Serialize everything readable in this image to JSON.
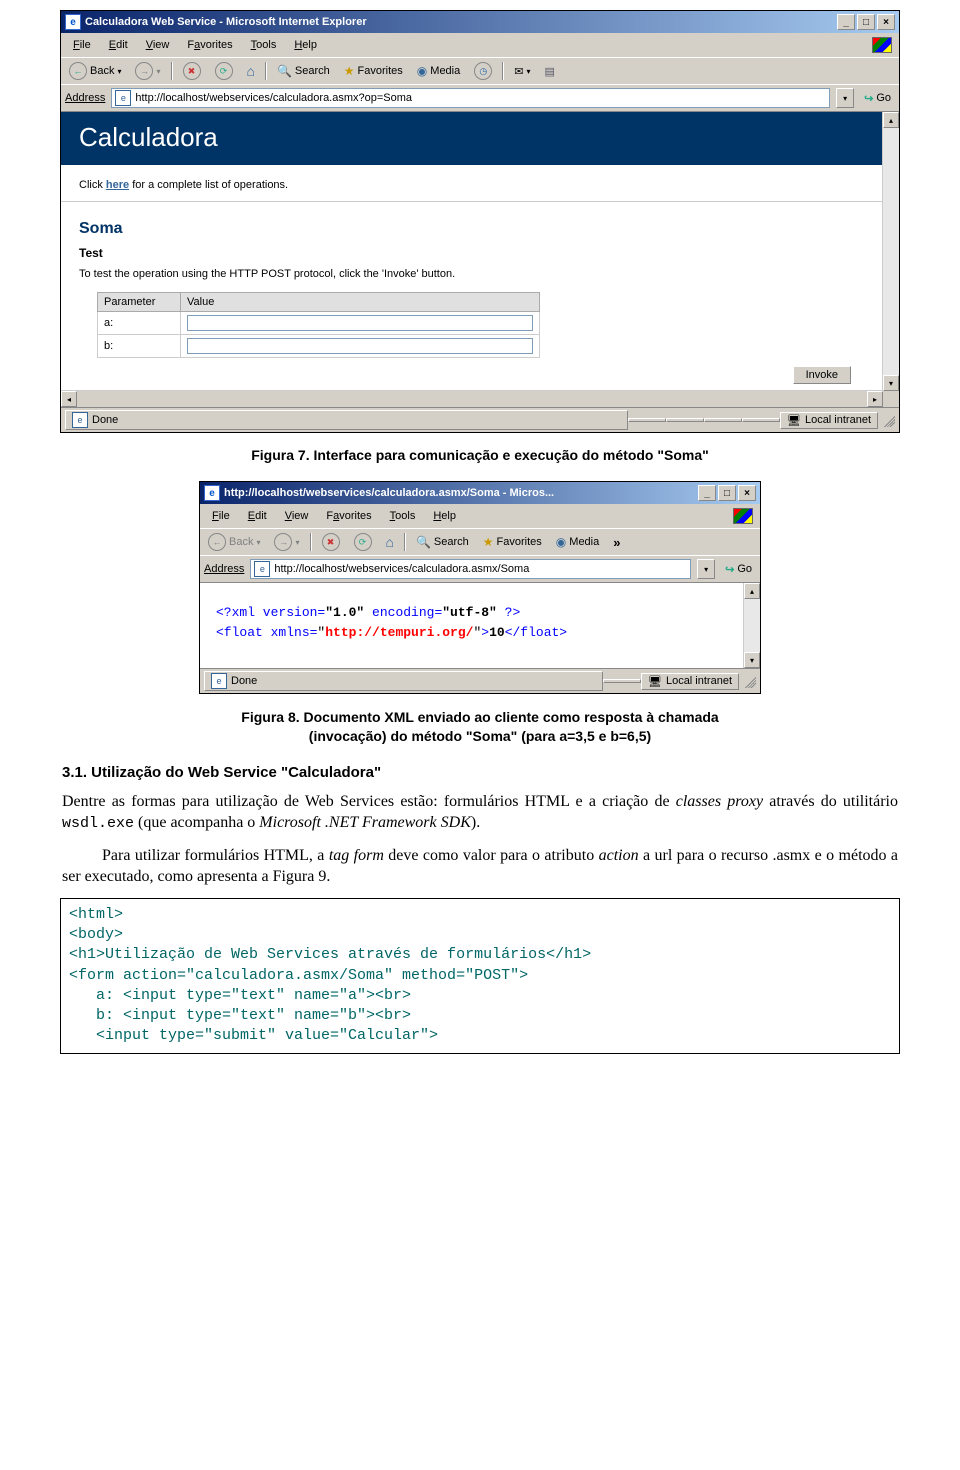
{
  "ie1": {
    "title": "Calculadora Web Service - Microsoft Internet Explorer",
    "menus": {
      "file": "File",
      "edit": "Edit",
      "view": "View",
      "favorites": "Favorites",
      "tools": "Tools",
      "help": "Help"
    },
    "toolbar": {
      "back": "Back",
      "search": "Search",
      "favorites": "Favorites",
      "media": "Media"
    },
    "address_label": "Address",
    "address_url": "http://localhost/webservices/calculadora.asmx?op=Soma",
    "go": "Go",
    "page_heading": "Calculadora",
    "click_prefix": "Click ",
    "click_link": "here",
    "click_suffix": " for a complete list of operations.",
    "method": "Soma",
    "test_label": "Test",
    "test_desc": "To test the operation using the HTTP POST protocol, click the 'Invoke' button.",
    "th_param": "Parameter",
    "th_value": "Value",
    "param_a": "a:",
    "param_b": "b:",
    "invoke": "Invoke",
    "status_done": "Done",
    "status_zone": "Local intranet"
  },
  "fig7": "Figura 7. Interface para comunicação e execução do método \"Soma\"",
  "ie2": {
    "title": "http://localhost/webservices/calculadora.asmx/Soma - Micros...",
    "menus": {
      "file": "File",
      "edit": "Edit",
      "view": "View",
      "favorites": "Favorites",
      "tools": "Tools",
      "help": "Help"
    },
    "toolbar": {
      "back": "Back",
      "search": "Search",
      "favorites": "Favorites",
      "media": "Media"
    },
    "address_label": "Address",
    "address_url": "http://localhost/webservices/calculadora.asmx/Soma",
    "go": "Go",
    "xml_decl_open": "<?xml version=",
    "xml_ver": "\"1.0\"",
    "xml_enc_lbl": " encoding=",
    "xml_enc": "\"utf-8\"",
    "xml_decl_close": " ?>",
    "float_open": "<float xmlns=",
    "float_ns": "\"http://tempuri.org/\"",
    "float_mid": ">",
    "float_val": "10",
    "float_close": "</float>",
    "status_done": "Done",
    "status_zone": "Local intranet"
  },
  "fig8_l1": "Figura 8. Documento XML enviado ao cliente como resposta à chamada",
  "fig8_l2": "(invocação) do método \"Soma\" (para a=3,5 e b=6,5)",
  "sect31": "3.1. Utilização do Web Service \"Calculadora\"",
  "para1_a": "Dentre as formas para utilização de Web Services estão: formulários HTML e a criação de ",
  "para1_b": "classes proxy",
  "para1_c": " através do utilitário ",
  "para1_d": "wsdl.exe",
  "para1_e": " (que acompanha o ",
  "para1_f": "Microsoft .NET Framework SDK",
  "para1_g": ").",
  "para2_a": "Para utilizar formulários HTML, a ",
  "para2_b": "tag form",
  "para2_c": " deve como valor para o atributo ",
  "para2_d": "action",
  "para2_e": " a url para o recurso .asmx e o método a ser executado, como apresenta a Figura 9.",
  "code": {
    "l1": "<html>",
    "l2": "<body>",
    "l3": "<h1>Utilização de Web Services através de formulários</h1>",
    "l4": "<form action=\"calculadora.asmx/Soma\" method=\"POST\">",
    "l5": "   a: <input type=\"text\" name=\"a\"><br>",
    "l6": "   b: <input type=\"text\" name=\"b\"><br>",
    "l7": "   <input type=\"submit\" value=\"Calcular\">"
  }
}
